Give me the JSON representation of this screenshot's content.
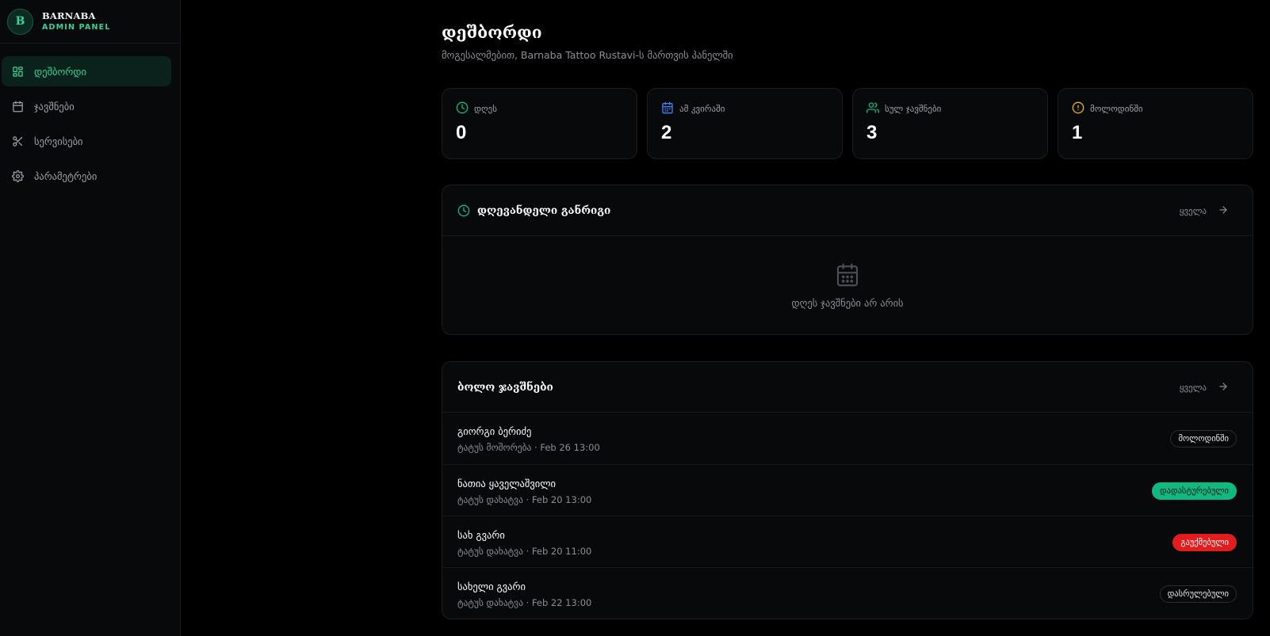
{
  "brand": {
    "logo_letter": "B",
    "name": "BARNABA",
    "subtitle": "ADMIN PANEL"
  },
  "sidebar": {
    "items": [
      {
        "label": "დეშბორდი",
        "icon": "grid-icon",
        "active": true
      },
      {
        "label": "ჯავშნები",
        "icon": "calendar-icon",
        "active": false
      },
      {
        "label": "სერვისები",
        "icon": "scissors-icon",
        "active": false
      },
      {
        "label": "პარამეტრები",
        "icon": "gear-icon",
        "active": false
      }
    ]
  },
  "page": {
    "title": "დეშბორდი",
    "subtitle": "მოგესალმებით, Barnaba Tattoo Rustavi-ს მართვის პანელში"
  },
  "stats": [
    {
      "label": "დღეს",
      "value": "0",
      "icon": "clock-icon",
      "color": "#10b981"
    },
    {
      "label": "ამ კვირაში",
      "value": "2",
      "icon": "calendar-icon",
      "color": "#3b82f6"
    },
    {
      "label": "სულ ჯავშნები",
      "value": "3",
      "icon": "users-icon",
      "color": "#10b981"
    },
    {
      "label": "მოლოდინში",
      "value": "1",
      "icon": "alert-circle-icon",
      "color": "#eab308"
    }
  ],
  "today_schedule": {
    "title": "დღევანდელი განრიგი",
    "see_all": "ყველა",
    "empty_text": "დღეს ჯავშნები არ არის"
  },
  "recent_bookings": {
    "title": "ბოლო ჯავშნები",
    "see_all": "ყველა",
    "rows": [
      {
        "name": "გიორგი ბერიძე",
        "meta": "ტატუს მოშორება · Feb 26 13:00",
        "status": "მოლოდინში",
        "status_type": "pending"
      },
      {
        "name": "ნათია ყაველაშვილი",
        "meta": "ტატუს დახატვა · Feb 20 13:00",
        "status": "დადასტურებული",
        "status_type": "confirmed"
      },
      {
        "name": "სახ გვარი",
        "meta": "ტატუს დახატვა · Feb 20 11:00",
        "status": "გაუქმებული",
        "status_type": "cancelled"
      },
      {
        "name": "სახელი გვარი",
        "meta": "ტატუს დახატვა · Feb 22 13:00",
        "status": "დასრულებული",
        "status_type": "completed"
      }
    ]
  },
  "colors": {
    "accent": "#34d399",
    "confirmed": "#10b981",
    "cancelled": "#e11d1d",
    "pending": "#eab308",
    "week": "#3b82f6"
  }
}
